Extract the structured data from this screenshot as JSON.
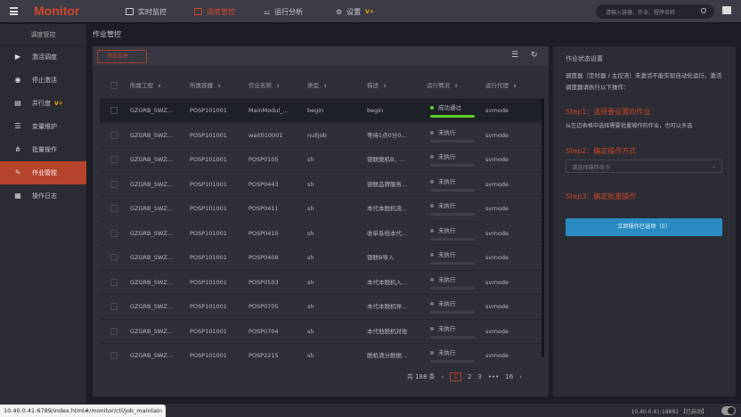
{
  "header": {
    "logo": "Monitor",
    "nav": [
      {
        "label": "实时监控"
      },
      {
        "label": "调度管控"
      },
      {
        "label": "运行分析"
      },
      {
        "label": "设置",
        "badge": "V+"
      }
    ],
    "search_placeholder": "请输入容器、作业、程序名称"
  },
  "sidebar": {
    "title": "调度管控",
    "items": [
      {
        "label": "激活调度",
        "icon": "play-icon"
      },
      {
        "label": "停止激活",
        "icon": "stop-circle-icon"
      },
      {
        "label": "并行度",
        "icon": "parallel-icon",
        "badge": "V+"
      },
      {
        "label": "变量维护",
        "icon": "sliders-icon"
      },
      {
        "label": "批量操作",
        "icon": "batch-icon"
      },
      {
        "label": "作业管控",
        "icon": "wrench-icon"
      },
      {
        "label": "操作日志",
        "icon": "log-icon"
      }
    ]
  },
  "breadcrumb": "作业管控",
  "toolbar": {
    "filter_label": "筛选条件 ›"
  },
  "table": {
    "headers": [
      "所属工程",
      "所属容器",
      "作业名称",
      "类型",
      "描述",
      "运行情况",
      "运行代理"
    ],
    "rows": [
      {
        "project": "GZGRB_SWZ...",
        "container": "POSP101001",
        "job": "MainModul_...",
        "type": "begin",
        "desc": "begin",
        "status": "成功通过",
        "progress": 1,
        "agent": "svrnode"
      },
      {
        "project": "GZGRB_SWZ...",
        "container": "POSP101001",
        "job": "wait010001",
        "type": "nulljob",
        "desc": "等待1点0分0...",
        "status": "未执行",
        "progress": 0,
        "agent": "svrnode"
      },
      {
        "project": "GZGRB_SWZ...",
        "container": "POSP101001",
        "job": "POSP0105",
        "type": "sh",
        "desc": "银联脱机B、...",
        "status": "未执行",
        "progress": 0,
        "agent": "svrnode"
      },
      {
        "project": "GZGRB_SWZ...",
        "container": "POSP101001",
        "job": "POSP0443",
        "type": "sh",
        "desc": "银联品牌服务...",
        "status": "未执行",
        "progress": 0,
        "agent": "svrnode"
      },
      {
        "project": "GZGRB_SWZ...",
        "container": "POSP101001",
        "job": "POSP0411",
        "type": "sh",
        "desc": "本代本脱机流...",
        "status": "未执行",
        "progress": 0,
        "agent": "svrnode"
      },
      {
        "project": "GZGRB_SWZ...",
        "container": "POSP101001",
        "job": "POSP0410",
        "type": "sh",
        "desc": "收单系统本代...",
        "status": "未执行",
        "progress": 0,
        "agent": "svrnode"
      },
      {
        "project": "GZGRB_SWZ...",
        "container": "POSP101001",
        "job": "POSP0408",
        "type": "sh",
        "desc": "银联B导入",
        "status": "未执行",
        "progress": 0,
        "agent": "svrnode"
      },
      {
        "project": "GZGRB_SWZ...",
        "container": "POSP101001",
        "job": "POSP0503",
        "type": "sh",
        "desc": "本代本脱机入...",
        "status": "未执行",
        "progress": 0,
        "agent": "svrnode"
      },
      {
        "project": "GZGRB_SWZ...",
        "container": "POSP101001",
        "job": "POSP0705",
        "type": "sh",
        "desc": "本代本脱机导...",
        "status": "未执行",
        "progress": 0,
        "agent": "svrnode"
      },
      {
        "project": "GZGRB_SWZ...",
        "container": "POSP101001",
        "job": "POSP0704",
        "type": "sh",
        "desc": "本代他脱机对账",
        "status": "未执行",
        "progress": 0,
        "agent": "svrnode"
      },
      {
        "project": "GZGRB_SWZ...",
        "container": "POSP101001",
        "job": "POSP2215",
        "type": "sh",
        "desc": "脱机清分数据...",
        "status": "未执行",
        "progress": 0,
        "agent": "svrnode"
      }
    ]
  },
  "pagination": {
    "total": "共 188 条",
    "prev": "‹",
    "pages": [
      "1",
      "2",
      "3",
      "•••",
      "16"
    ],
    "next": "›"
  },
  "right_panel": {
    "title": "作业状态设置",
    "desc": "调度器（定时器 / 主控流）未激活不能实现自动化运行。激活调度器请执行以下操作：",
    "step1": "Step1：选择要设置的作业",
    "step1_note": "从左边表格中选择需要批量操作的作业，也可以多选",
    "step2": "Step2：确定操作方式",
    "select_placeholder": "请选择操作命令",
    "step3": "Step3：确定批量操作",
    "action_button": "立即操作已选项（0）"
  },
  "statusbar": {
    "url": "10.40.0.41:6789/index.html#/monitor/ctl/job_maintain",
    "server": "10.40.0.41:18881 【已启动】"
  },
  "colors": {
    "accent": "#d2472a",
    "success": "#5ad12a",
    "primary": "#2a8bc3"
  }
}
